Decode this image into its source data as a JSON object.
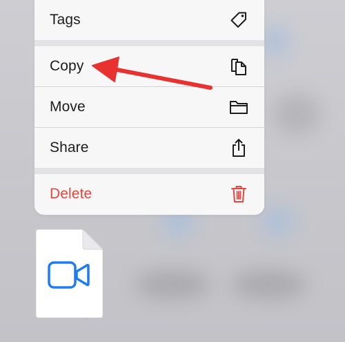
{
  "menu": {
    "items": [
      {
        "label": "Tags",
        "icon": "tag-icon"
      },
      {
        "label": "Copy",
        "icon": "copy-icon"
      },
      {
        "label": "Move",
        "icon": "folder-icon"
      },
      {
        "label": "Share",
        "icon": "share-icon"
      },
      {
        "label": "Delete",
        "icon": "trash-icon"
      }
    ]
  },
  "file": {
    "icon": "video-camera-icon"
  },
  "colors": {
    "destructive": "#e5463e",
    "accent_blue": "#1e7cf2",
    "arrow_red": "#e8322f"
  }
}
